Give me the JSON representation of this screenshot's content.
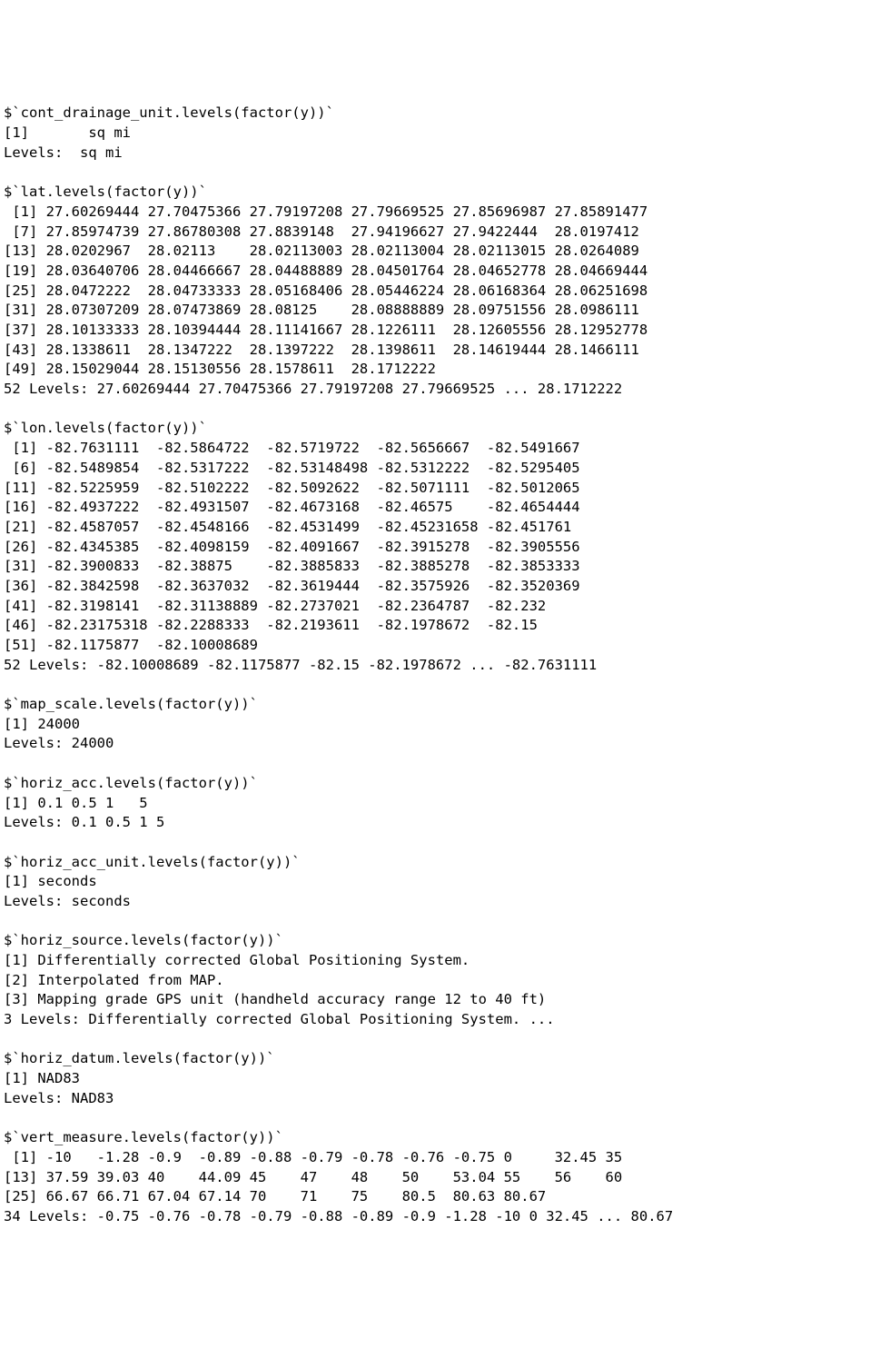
{
  "sections": [
    {
      "name": "cont_drainage_unit",
      "header": "$`cont_drainage_unit.levels(factor(y))`",
      "lines": [
        "[1]       sq mi",
        "Levels:  sq mi"
      ]
    },
    {
      "name": "lat",
      "header": "$`lat.levels(factor(y))`",
      "lines": [
        " [1] 27.60269444 27.70475366 27.79197208 27.79669525 27.85696987 27.85891477",
        " [7] 27.85974739 27.86780308 27.8839148  27.94196627 27.9422444  28.0197412 ",
        "[13] 28.0202967  28.02113    28.02113003 28.02113004 28.02113015 28.0264089 ",
        "[19] 28.03640706 28.04466667 28.04488889 28.04501764 28.04652778 28.04669444",
        "[25] 28.0472222  28.04733333 28.05168406 28.05446224 28.06168364 28.06251698",
        "[31] 28.07307209 28.07473869 28.08125    28.08888889 28.09751556 28.0986111 ",
        "[37] 28.10133333 28.10394444 28.11141667 28.1226111  28.12605556 28.12952778",
        "[43] 28.1338611  28.1347222  28.1397222  28.1398611  28.14619444 28.1466111 ",
        "[49] 28.15029044 28.15130556 28.1578611  28.1712222 ",
        "52 Levels: 27.60269444 27.70475366 27.79197208 27.79669525 ... 28.1712222"
      ]
    },
    {
      "name": "lon",
      "header": "$`lon.levels(factor(y))`",
      "lines": [
        " [1] -82.7631111  -82.5864722  -82.5719722  -82.5656667  -82.5491667 ",
        " [6] -82.5489854  -82.5317222  -82.53148498 -82.5312222  -82.5295405 ",
        "[11] -82.5225959  -82.5102222  -82.5092622  -82.5071111  -82.5012065 ",
        "[16] -82.4937222  -82.4931507  -82.4673168  -82.46575    -82.4654444 ",
        "[21] -82.4587057  -82.4548166  -82.4531499  -82.45231658 -82.451761  ",
        "[26] -82.4345385  -82.4098159  -82.4091667  -82.3915278  -82.3905556 ",
        "[31] -82.3900833  -82.38875    -82.3885833  -82.3885278  -82.3853333 ",
        "[36] -82.3842598  -82.3637032  -82.3619444  -82.3575926  -82.3520369 ",
        "[41] -82.3198141  -82.31138889 -82.2737021  -82.2364787  -82.232     ",
        "[46] -82.23175318 -82.2288333  -82.2193611  -82.1978672  -82.15      ",
        "[51] -82.1175877  -82.10008689",
        "52 Levels: -82.10008689 -82.1175877 -82.15 -82.1978672 ... -82.7631111"
      ]
    },
    {
      "name": "map_scale",
      "header": "$`map_scale.levels(factor(y))`",
      "lines": [
        "[1] 24000",
        "Levels: 24000"
      ]
    },
    {
      "name": "horiz_acc",
      "header": "$`horiz_acc.levels(factor(y))`",
      "lines": [
        "[1] 0.1 0.5 1   5  ",
        "Levels: 0.1 0.5 1 5"
      ]
    },
    {
      "name": "horiz_acc_unit",
      "header": "$`horiz_acc_unit.levels(factor(y))`",
      "lines": [
        "[1] seconds",
        "Levels: seconds"
      ]
    },
    {
      "name": "horiz_source",
      "header": "$`horiz_source.levels(factor(y))`",
      "lines": [
        "[1] Differentially corrected Global Positioning System.            ",
        "[2] Interpolated from MAP.                                          ",
        "[3] Mapping grade GPS unit (handheld accuracy range 12 to 40 ft)    ",
        "3 Levels: Differentially corrected Global Positioning System. ..."
      ]
    },
    {
      "name": "horiz_datum",
      "header": "$`horiz_datum.levels(factor(y))`",
      "lines": [
        "[1] NAD83",
        "Levels: NAD83"
      ]
    },
    {
      "name": "vert_measure",
      "header": "$`vert_measure.levels(factor(y))`",
      "lines": [
        " [1] -10   -1.28 -0.9  -0.89 -0.88 -0.79 -0.78 -0.76 -0.75 0     32.45 35   ",
        "[13] 37.59 39.03 40    44.09 45    47    48    50    53.04 55    56    60   ",
        "[25] 66.67 66.71 67.04 67.14 70    71    75    80.5  80.63 80.67",
        "34 Levels: -0.75 -0.76 -0.78 -0.79 -0.88 -0.89 -0.9 -1.28 -10 0 32.45 ... 80.67"
      ]
    }
  ]
}
